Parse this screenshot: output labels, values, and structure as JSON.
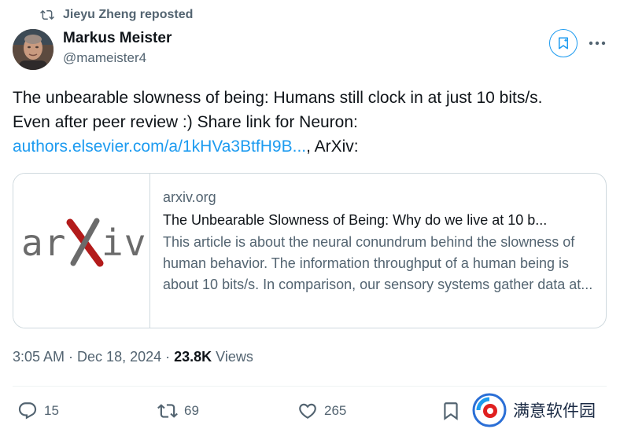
{
  "repost_banner": {
    "text": "Jieyu Zheng reposted",
    "icon": "repost-icon"
  },
  "author": {
    "name": "Markus Meister",
    "handle": "@mameister4",
    "avatar": "avatar-photo"
  },
  "header_buttons": {
    "grok": "grok-icon",
    "more": "more-icon"
  },
  "tweet": {
    "line1": "The unbearable slowness of being: Humans still clock in at just 10 bits/s.",
    "line2": "Even after peer review :) Share link for Neuron:",
    "link": "authors.elsevier.com/a/1kHVa3BtfH9B...",
    "after_link": ", ArXiv:"
  },
  "card": {
    "logo_text": "arXiv",
    "domain": "arxiv.org",
    "title": "The Unbearable Slowness of Being: Why do we live at 10 b...",
    "description": "This article is about the neural conundrum behind the slowness of human behavior. The information throughput of a human being is about 10 bits/s. In comparison, our sensory systems gather data at..."
  },
  "meta": {
    "time": "3:05 AM",
    "sep1": " · ",
    "date": "Dec 18, 2024",
    "sep2": " · ",
    "views_count": "23.8K",
    "views_label": " Views"
  },
  "actions": {
    "replies": "15",
    "reposts": "69",
    "likes": "265"
  },
  "watermark": {
    "text": "满意软件园"
  },
  "colors": {
    "accent": "#1d9bf0",
    "secondary_text": "#536471",
    "primary_text": "#0f1419",
    "border": "#cfd9de"
  }
}
